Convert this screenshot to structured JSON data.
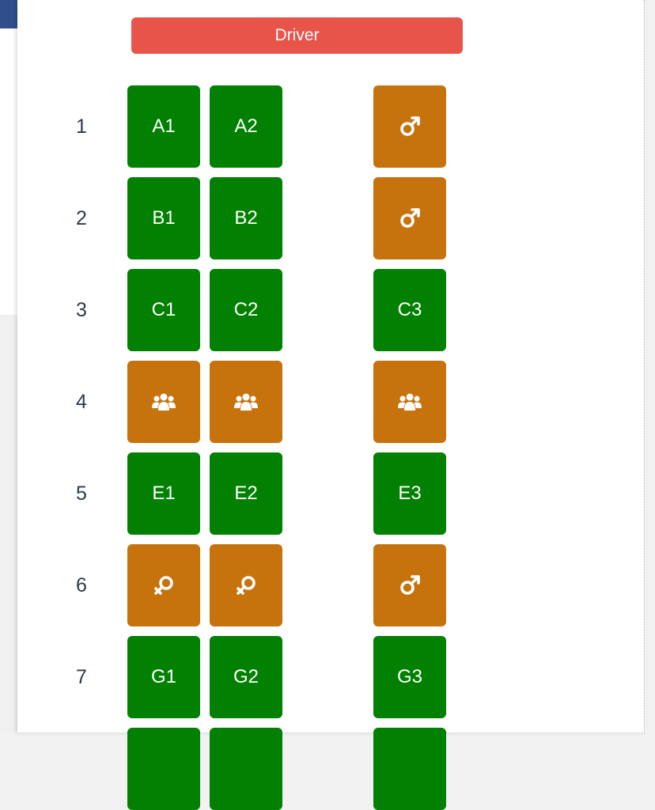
{
  "driver_label": "Driver",
  "colors": {
    "available": "#018001",
    "occupied": "#c6720d",
    "driver": "#e8534a"
  },
  "rows": [
    {
      "number": "1",
      "seats": [
        {
          "label": "A1",
          "status": "available"
        },
        {
          "label": "A2",
          "status": "available"
        },
        {
          "icon": "male-icon",
          "status": "occupied"
        }
      ]
    },
    {
      "number": "2",
      "seats": [
        {
          "label": "B1",
          "status": "available"
        },
        {
          "label": "B2",
          "status": "available"
        },
        {
          "icon": "male-icon",
          "status": "occupied"
        }
      ]
    },
    {
      "number": "3",
      "seats": [
        {
          "label": "C1",
          "status": "available"
        },
        {
          "label": "C2",
          "status": "available"
        },
        {
          "label": "C3",
          "status": "available"
        }
      ]
    },
    {
      "number": "4",
      "seats": [
        {
          "icon": "group-icon",
          "status": "occupied"
        },
        {
          "icon": "group-icon",
          "status": "occupied"
        },
        {
          "icon": "group-icon",
          "status": "occupied"
        }
      ]
    },
    {
      "number": "5",
      "seats": [
        {
          "label": "E1",
          "status": "available"
        },
        {
          "label": "E2",
          "status": "available"
        },
        {
          "label": "E3",
          "status": "available"
        }
      ]
    },
    {
      "number": "6",
      "seats": [
        {
          "icon": "female-icon",
          "status": "occupied"
        },
        {
          "icon": "female-icon",
          "status": "occupied"
        },
        {
          "icon": "male-icon",
          "status": "occupied"
        }
      ]
    },
    {
      "number": "7",
      "seats": [
        {
          "label": "G1",
          "status": "available"
        },
        {
          "label": "G2",
          "status": "available"
        },
        {
          "label": "G3",
          "status": "available"
        }
      ]
    },
    {
      "number": "",
      "seats": [
        {
          "label": "",
          "status": "available"
        },
        {
          "label": "",
          "status": "available"
        },
        {
          "label": "",
          "status": "available"
        }
      ]
    }
  ]
}
